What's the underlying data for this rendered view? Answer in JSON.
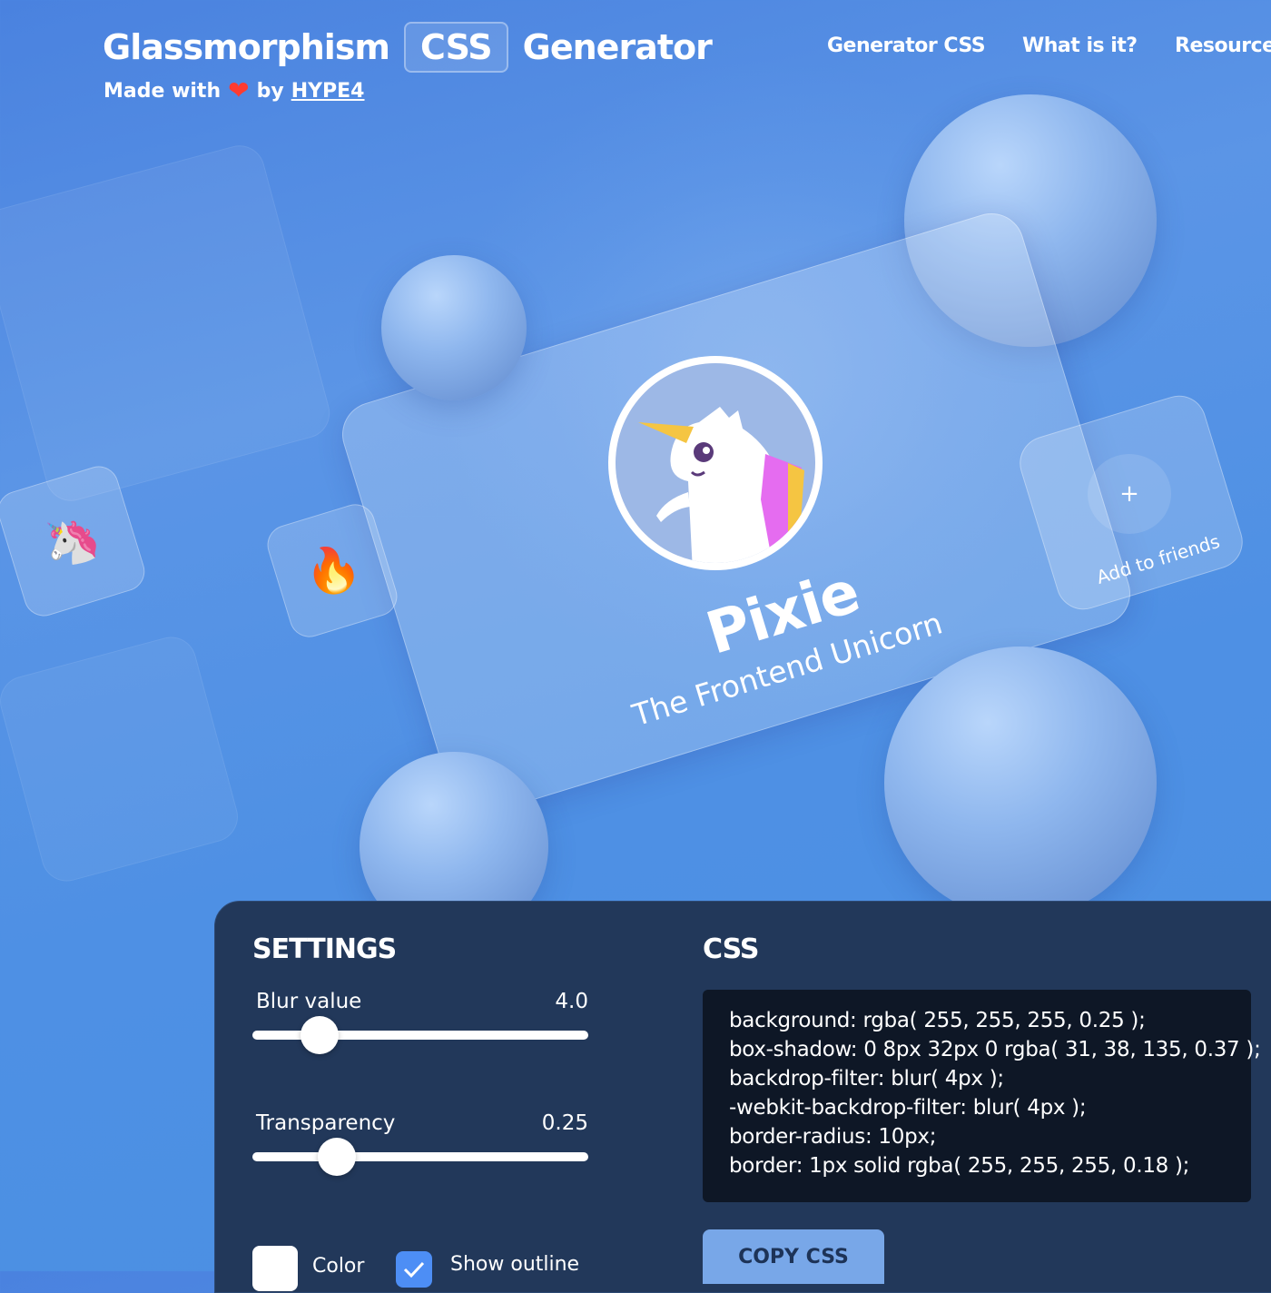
{
  "header": {
    "title_part1": "Glassmorphism",
    "title_badge": "CSS",
    "title_part2": "Generator",
    "made_with": "Made with",
    "by": "by",
    "author": "HYPE4"
  },
  "nav": {
    "items": [
      "Generator CSS",
      "What is it?",
      "Resources"
    ]
  },
  "card": {
    "name": "Pixie",
    "subtitle": "The Frontend Unicorn"
  },
  "friends": {
    "plus": "+",
    "label": "Add to friends"
  },
  "emoji_tiles": {
    "tile1": "🦄",
    "tile2": "🔥"
  },
  "settings": {
    "title": "SETTINGS",
    "blur": {
      "label": "Blur value",
      "value": "4.0",
      "fraction": 0.2
    },
    "transparency": {
      "label": "Transparency",
      "value": "0.25",
      "fraction": 0.25
    },
    "color_label": "Color",
    "outline_label": "Show outline",
    "outline_checked": true
  },
  "css": {
    "title": "CSS",
    "lines": [
      "background: rgba( 255, 255, 255, 0.25 );",
      "box-shadow: 0 8px 32px 0 rgba( 31, 38, 135, 0.37 );",
      "backdrop-filter: blur( 4px );",
      "-webkit-backdrop-filter: blur( 4px );",
      "border-radius: 10px;",
      "border: 1px solid rgba( 255, 255, 255, 0.18 );"
    ],
    "copy_button": "COPY CSS"
  },
  "colors": {
    "panel": "#22385a",
    "code_bg": "#0e1726",
    "copy_button": "#78a7e8",
    "checkbox_checked": "#4d8ef5",
    "heart": "#ff3b30"
  }
}
